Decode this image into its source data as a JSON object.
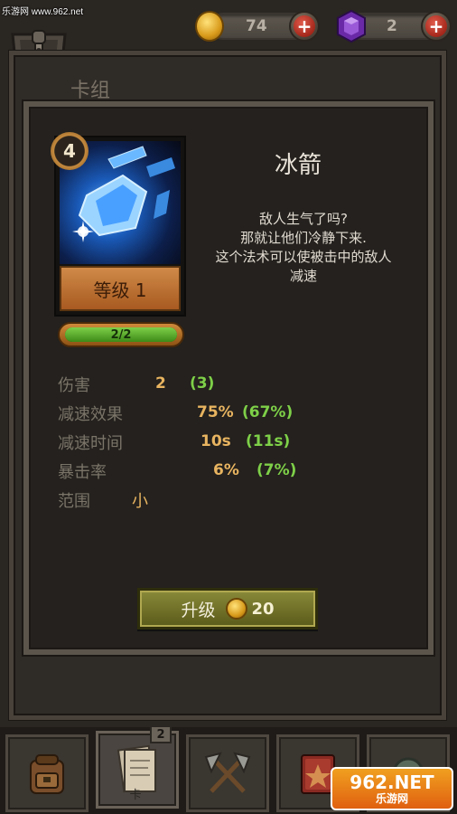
{
  "watermark_top": "乐游网 www.962.net",
  "currency": {
    "gold_value": "74",
    "gem_value": "2",
    "add_gold_label": "+",
    "add_gem_label": "+"
  },
  "header": {
    "title": "卡组"
  },
  "card": {
    "cost": "4",
    "level_label": "等级 1",
    "progress_text": "2/2",
    "progress_fraction": 1.0,
    "name": "冰箭",
    "description_lines": [
      "敌人生气了吗?",
      "那就让他们冷静下来.",
      "这个法术可以使被击中的敌人",
      "减速"
    ]
  },
  "stats": [
    {
      "label": "伤害",
      "value": "2",
      "next": "(3)"
    },
    {
      "label": "减速效果",
      "value": "75%",
      "next": "(67%)"
    },
    {
      "label": "减速时间",
      "value": "10s",
      "next": "(11s)"
    },
    {
      "label": "暴击率",
      "value": "6%",
      "next": "(7%)"
    },
    {
      "label": "范围",
      "value": "小",
      "next": ""
    }
  ],
  "upgrade": {
    "label": "升级",
    "cost": "20"
  },
  "bottom_nav": {
    "tabs": [
      {
        "name": "backpack-icon"
      },
      {
        "name": "cards-icon",
        "badge": "2",
        "label": "卡"
      },
      {
        "name": "crossed-axes-icon"
      },
      {
        "name": "spellbook-icon"
      },
      {
        "name": "gear-icon"
      }
    ]
  },
  "watermark_bottom": {
    "big": "962.NET",
    "small": "乐游网"
  },
  "colors": {
    "accent_gold": "#e8b460",
    "accent_green": "#7ed048",
    "plus_red": "#c0392b",
    "gem_purple": "#6a2aa8"
  }
}
